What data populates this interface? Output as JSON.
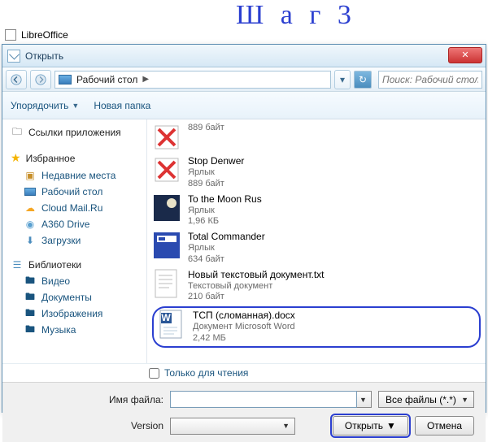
{
  "handwriting": "Ш а г 3",
  "app_title": "LibreOffice",
  "dialog": {
    "title": "Открыть",
    "breadcrumb": "Рабочий стол",
    "search_placeholder": "Поиск: Рабочий стол"
  },
  "toolbar": {
    "organize": "Упорядочить",
    "new_folder": "Новая папка"
  },
  "sidebar": {
    "app_links": "Ссылки приложения",
    "favorites": "Избранное",
    "fav_items": [
      "Недавние места",
      "Рабочий стол",
      "Cloud Mail.Ru",
      "A360 Drive",
      "Загрузки"
    ],
    "libraries": "Библиотеки",
    "lib_items": [
      "Видео",
      "Документы",
      "Изображения",
      "Музыка"
    ]
  },
  "files": [
    {
      "name": "",
      "type": "",
      "size": "889 байт"
    },
    {
      "name": "Stop Denwer",
      "type": "Ярлык",
      "size": "889 байт"
    },
    {
      "name": "To the Moon Rus",
      "type": "Ярлык",
      "size": "1,96 КБ"
    },
    {
      "name": "Total Commander",
      "type": "Ярлык",
      "size": "634 байт"
    },
    {
      "name": "Новый текстовый документ.txt",
      "type": "Текстовый документ",
      "size": "210 байт"
    },
    {
      "name": "ТСП (сломанная).docx",
      "type": "Документ Microsoft Word",
      "size": "2,42 МБ"
    }
  ],
  "readonly_label": "Только для чтения",
  "form": {
    "filename_label": "Имя файла:",
    "filter_label": "Все файлы (*.*)",
    "version_label": "Version",
    "open_btn": "Открыть",
    "cancel_btn": "Отмена"
  }
}
